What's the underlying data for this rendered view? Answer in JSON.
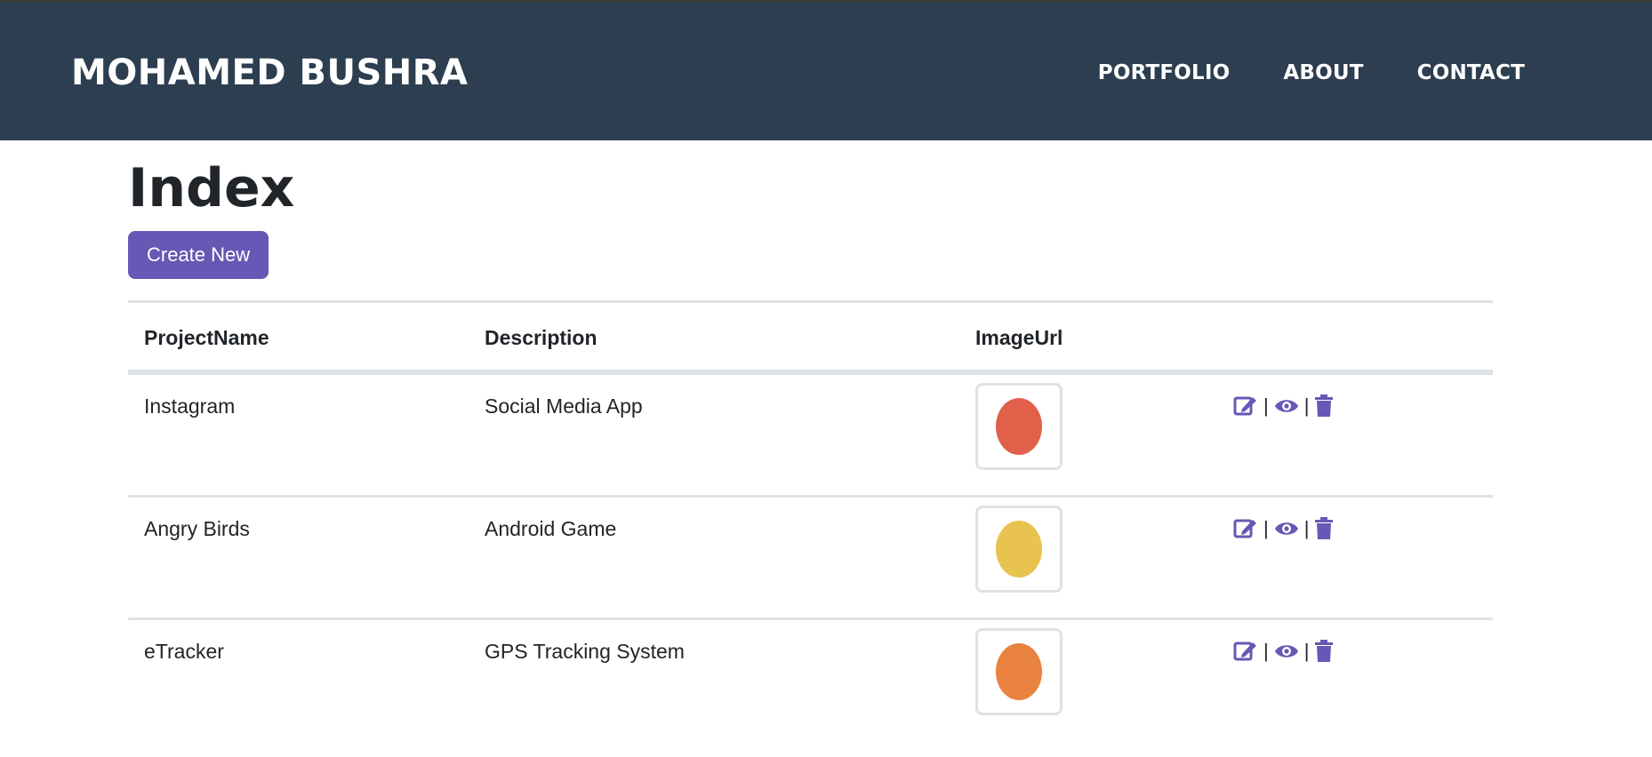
{
  "header": {
    "brand": "MOHAMED BUSHRA",
    "nav": [
      "PORTFOLIO",
      "ABOUT",
      "CONTACT"
    ]
  },
  "page": {
    "title": "Index",
    "create_label": "Create New"
  },
  "table": {
    "columns": [
      "ProjectName",
      "Description",
      "ImageUrl"
    ],
    "rows": [
      {
        "name": "Instagram",
        "description": "Social Media App",
        "thumb_bg": "#22a7b8",
        "thumb_fg": "#e0604a"
      },
      {
        "name": "Angry Birds",
        "description": "Android Game",
        "thumb_bg": "#1a3dbf",
        "thumb_fg": "#e8c34f"
      },
      {
        "name": "eTracker",
        "description": "GPS Tracking System",
        "thumb_bg": "#2e8fd0",
        "thumb_fg": "#e8823e"
      }
    ],
    "action_separator": "|"
  },
  "colors": {
    "navbar": "#2c3e50",
    "accent": "#6658b5"
  }
}
